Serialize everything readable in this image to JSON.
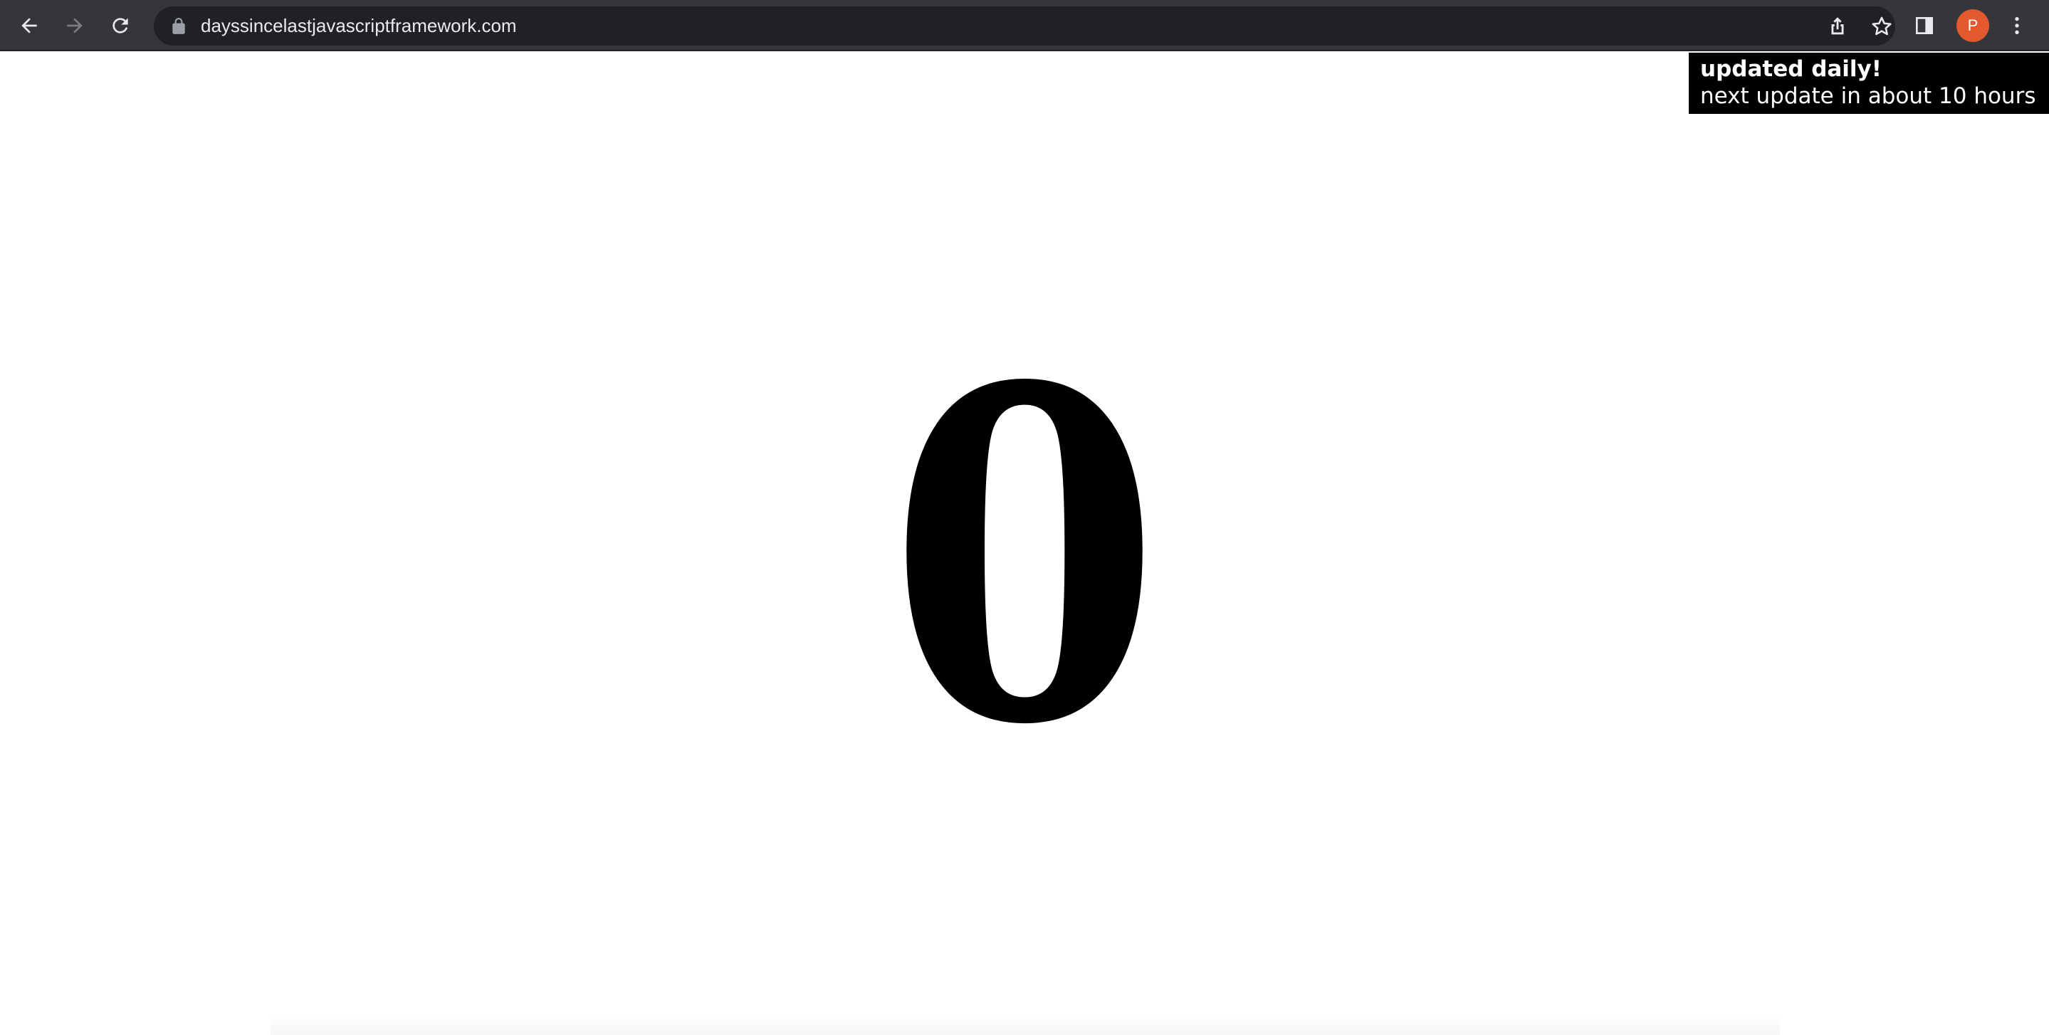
{
  "browser": {
    "url": "dayssincelastjavascriptframework.com",
    "profile_initial": "P",
    "profile_color": "#e2582f",
    "icons": {
      "back": "arrow-left-icon",
      "forward": "arrow-right-icon",
      "reload": "reload-icon",
      "lock": "lock-icon",
      "share": "share-icon",
      "bookmark": "star-icon",
      "side_panel": "side-panel-icon",
      "menu": "kebab-menu-icon"
    }
  },
  "page": {
    "notice": {
      "title": "updated daily!",
      "subtitle": "next update in about 10 hours"
    },
    "days_count": "0"
  }
}
